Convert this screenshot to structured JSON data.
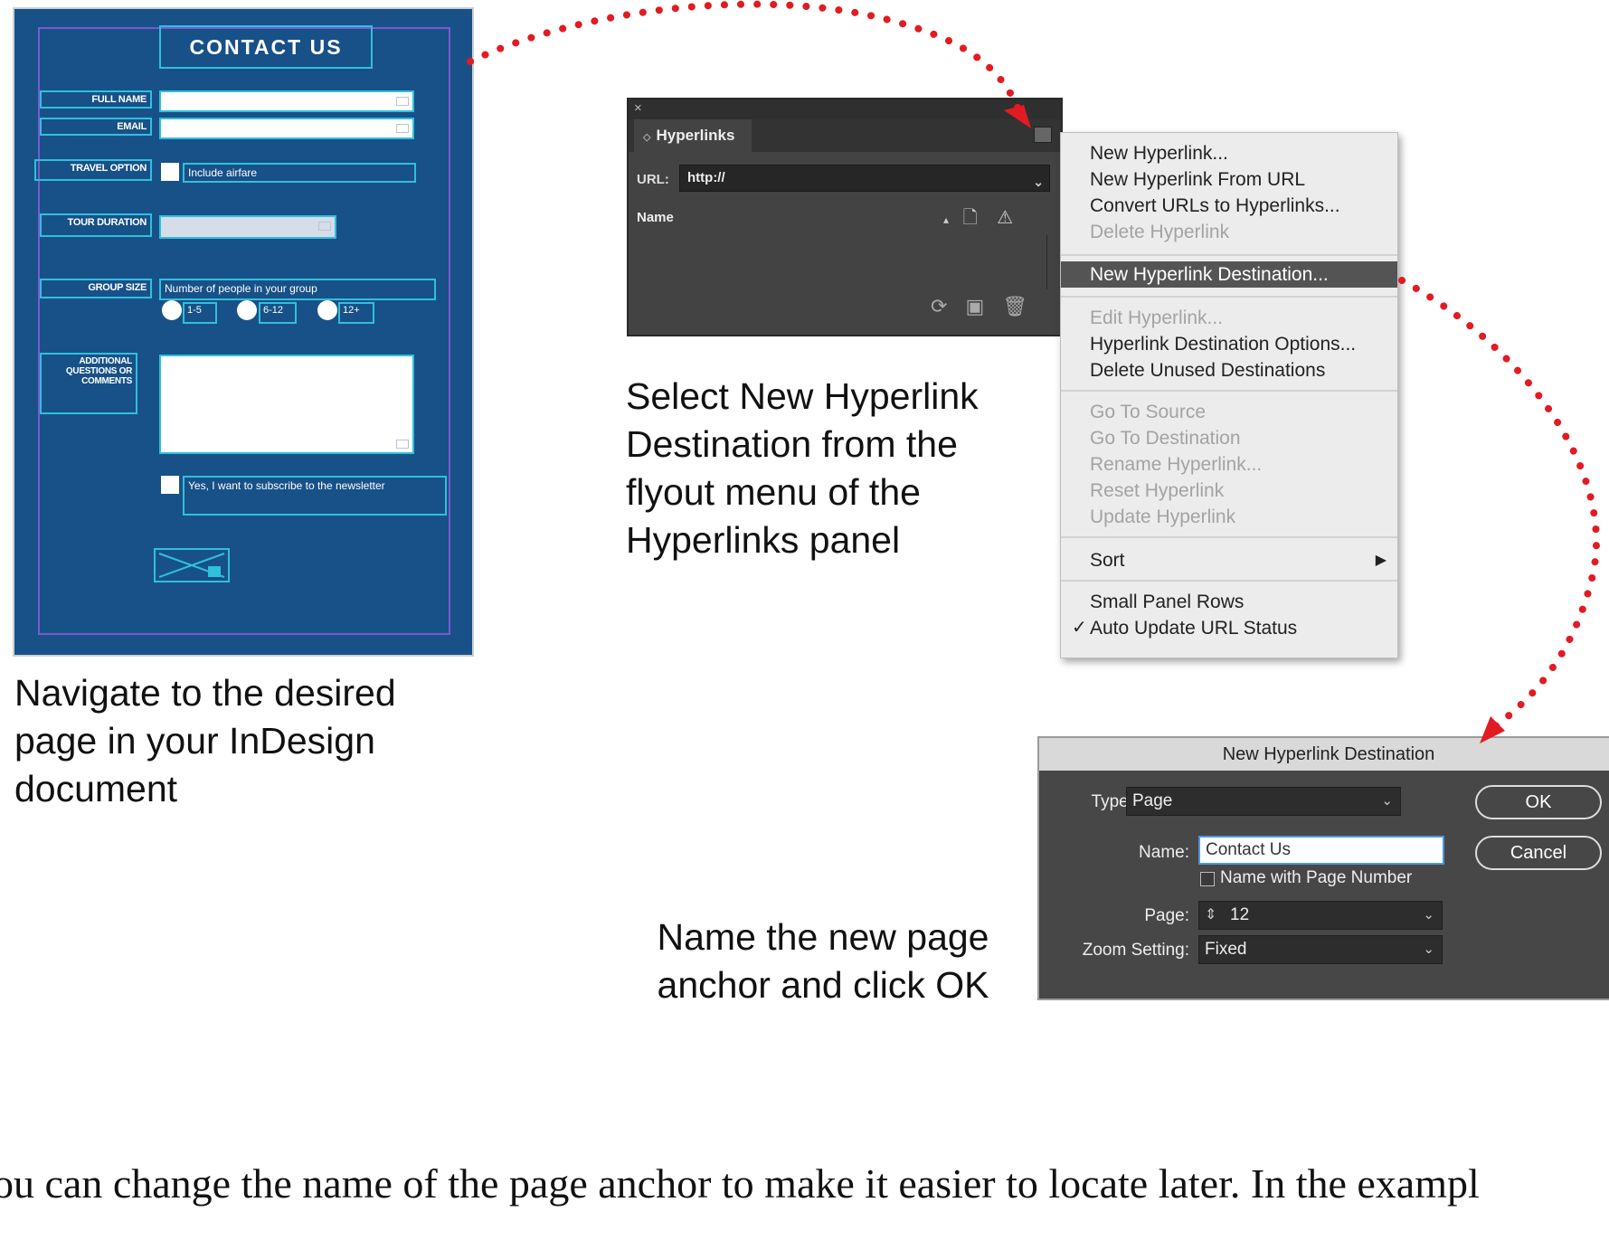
{
  "form": {
    "title": "CONTACT US",
    "labels": {
      "full_name": "FULL NAME",
      "email": "EMAIL",
      "travel_option": "TRAVEL OPTION",
      "tour_duration": "TOUR DURATION",
      "group_size": "GROUP SIZE",
      "additional": "ADDITIONAL QUESTIONS OR COMMENTS"
    },
    "include_airfare": "Include airfare",
    "group_size_hint": "Number of people in your group",
    "radio_options": [
      "1-5",
      "6-12",
      "12+"
    ],
    "newsletter": "Yes, I want to subscribe to the newsletter"
  },
  "captions": {
    "navigate": "Navigate to the desired page in your InDesign document",
    "select": "Select New Hyperlink Destination from the flyout menu of the Hyperlinks panel",
    "name_anchor": "Name the new page anchor and click OK"
  },
  "panel": {
    "close": "×",
    "tab": "Hyperlinks",
    "url_label": "URL:",
    "url_value": "http://",
    "name_header": "Name"
  },
  "menu": {
    "items": [
      {
        "label": "New Hyperlink...",
        "state": "enabled"
      },
      {
        "label": "New Hyperlink From URL",
        "state": "enabled"
      },
      {
        "label": "Convert URLs to Hyperlinks...",
        "state": "enabled"
      },
      {
        "label": "Delete Hyperlink",
        "state": "disabled"
      },
      {
        "label": "New Hyperlink Destination...",
        "state": "selected"
      },
      {
        "label": "Edit Hyperlink...",
        "state": "disabled"
      },
      {
        "label": "Hyperlink Destination Options...",
        "state": "enabled"
      },
      {
        "label": "Delete Unused Destinations",
        "state": "enabled"
      },
      {
        "label": "Go To Source",
        "state": "disabled"
      },
      {
        "label": "Go To Destination",
        "state": "disabled"
      },
      {
        "label": "Rename Hyperlink...",
        "state": "disabled"
      },
      {
        "label": "Reset Hyperlink",
        "state": "disabled"
      },
      {
        "label": "Update Hyperlink",
        "state": "disabled"
      },
      {
        "label": "Sort",
        "state": "enabled"
      },
      {
        "label": "Small Panel Rows",
        "state": "enabled"
      },
      {
        "label": "Auto Update URL Status",
        "state": "checked"
      }
    ]
  },
  "dialog": {
    "title": "New Hyperlink Destination",
    "type_label": "Type:",
    "type_value": "Page",
    "name_label": "Name:",
    "name_value": "Contact Us",
    "name_with_page_number": "Name with Page Number",
    "page_label": "Page:",
    "page_value": "12",
    "zoom_label": "Zoom Setting:",
    "zoom_value": "Fixed",
    "ok": "OK",
    "cancel": "Cancel"
  },
  "body_text": "ou can change the name of the page anchor to make it easier to locate later. In the exampl",
  "colors": {
    "form_bg": "#175188",
    "guide_cyan": "#2fc0dc",
    "margin_purple": "#7a5bc9",
    "arrow_red": "#e21b23",
    "panel_dark": "#434343"
  }
}
